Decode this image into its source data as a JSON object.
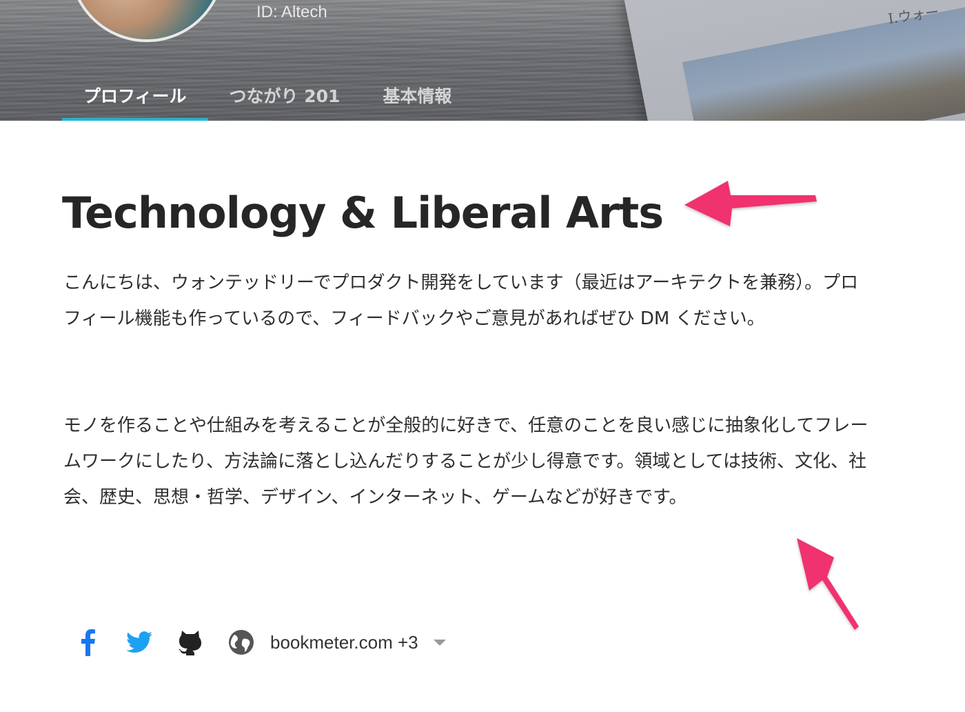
{
  "header": {
    "user_id": "ID: Altech",
    "cover_text": "I.ウォー",
    "tabs": [
      {
        "label": "プロフィール",
        "active": true
      },
      {
        "label": "つながり 201",
        "active": false
      },
      {
        "label": "基本情報",
        "active": false
      }
    ],
    "accent_color": "#22b5d3"
  },
  "profile": {
    "headline": "Technology & Liberal Arts",
    "paragraphs": [
      "こんにちは、ウォンテッドリーでプロダクト開発をしています（最近はアーキテクトを兼務）。プロフィール機能も作っているので、フィードバックやご意見があればぜひ DM ください。",
      "モノを作ることや仕組みを考えることが全般的に好きで、任意のことを良い感じに抽象化してフレームワークにしたり、方法論に落とし込んだりすることが少し得意です。領域としては技術、文化、社会、歴史、思想・哲学、デザイン、インターネット、ゲームなどが好きです。"
    ]
  },
  "links": {
    "icons": [
      "facebook-icon",
      "twitter-icon",
      "github-icon",
      "globe-icon"
    ],
    "website_label": "bookmeter.com +3",
    "colors": {
      "facebook": "#1877f2",
      "twitter": "#1da1f2",
      "github": "#222222",
      "globe": "#555555"
    }
  },
  "annotations": {
    "arrow_color": "#f0326e"
  }
}
